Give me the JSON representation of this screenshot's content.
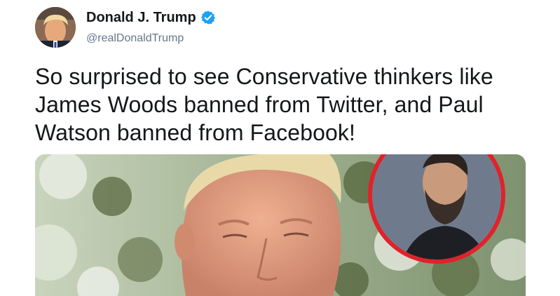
{
  "author": {
    "display_name": "Donald J. Trump",
    "handle": "@realDonaldTrump",
    "verified": true
  },
  "icons": {
    "verified": "verified-badge-icon",
    "avatar": "profile-photo"
  },
  "tweet": {
    "lines": [
      "So surprised to see Conservative thinkers like",
      "James Woods banned from Twitter, and Paul",
      "Watson banned from Facebook!"
    ]
  },
  "colors": {
    "verified_blue": "#1da1f2",
    "text": "#14171a",
    "secondary": "#657786",
    "inset_ring": "#e0222a"
  }
}
